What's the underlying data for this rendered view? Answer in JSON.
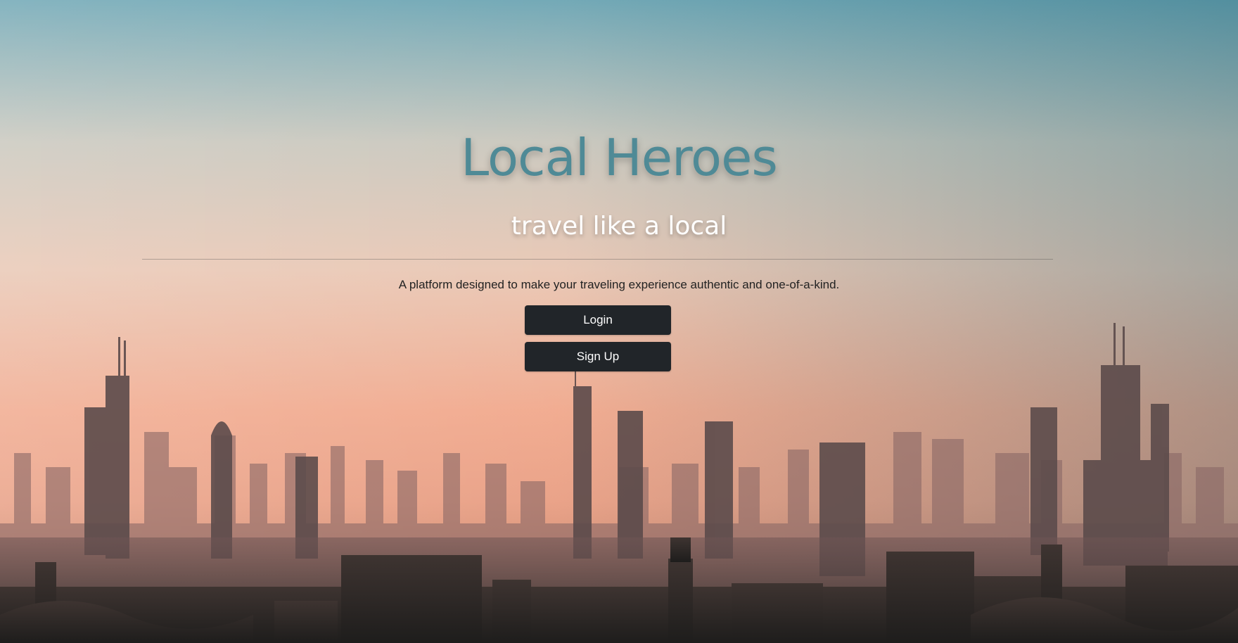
{
  "hero": {
    "title": "Local Heroes",
    "subtitle": "travel like a local",
    "tagline": "A platform designed to make your traveling experience authentic and one-of-a-kind.",
    "buttons": {
      "login_label": "Login",
      "signup_label": "Sign Up"
    }
  },
  "colors": {
    "title": "#4f8a96",
    "button_bg": "#212529",
    "button_text": "#ffffff"
  }
}
